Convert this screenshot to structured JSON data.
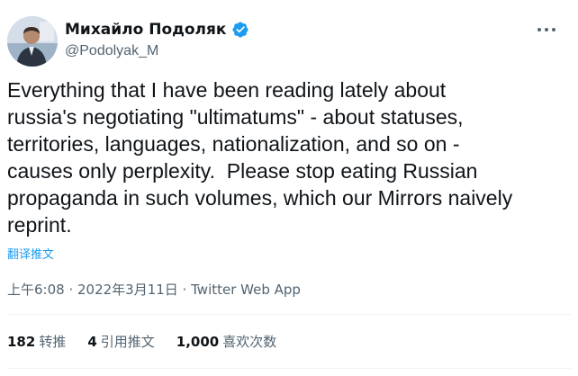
{
  "author": {
    "display_name": "Михайло Подоляк",
    "handle": "@Podolyak_M",
    "verified": true
  },
  "tweet": {
    "text": "Everything that I have been reading lately about\nrussia's negotiating \"ultimatums\" - about statuses,\nterritories, languages, nationalization, and so on -\ncauses only perplexity.  Please stop eating Russian\npropaganda in such volumes, which our Mirrors naively\nreprint.",
    "translate_label": "翻译推文"
  },
  "meta": {
    "time": "上午6:08",
    "separator": " · ",
    "date": "2022年3月11日",
    "source": "Twitter Web App"
  },
  "stats": [
    {
      "count": "182",
      "label": "转推"
    },
    {
      "count": "4",
      "label": "引用推文"
    },
    {
      "count": "1,000",
      "label": "喜欢次数"
    }
  ],
  "colors": {
    "accent": "#1d9bf0",
    "text": "#0f1419",
    "secondary": "#536471",
    "divider": "#eff3f4"
  },
  "icons": {
    "verified": "verified-badge-icon",
    "more": "more-horizontal-icon"
  }
}
